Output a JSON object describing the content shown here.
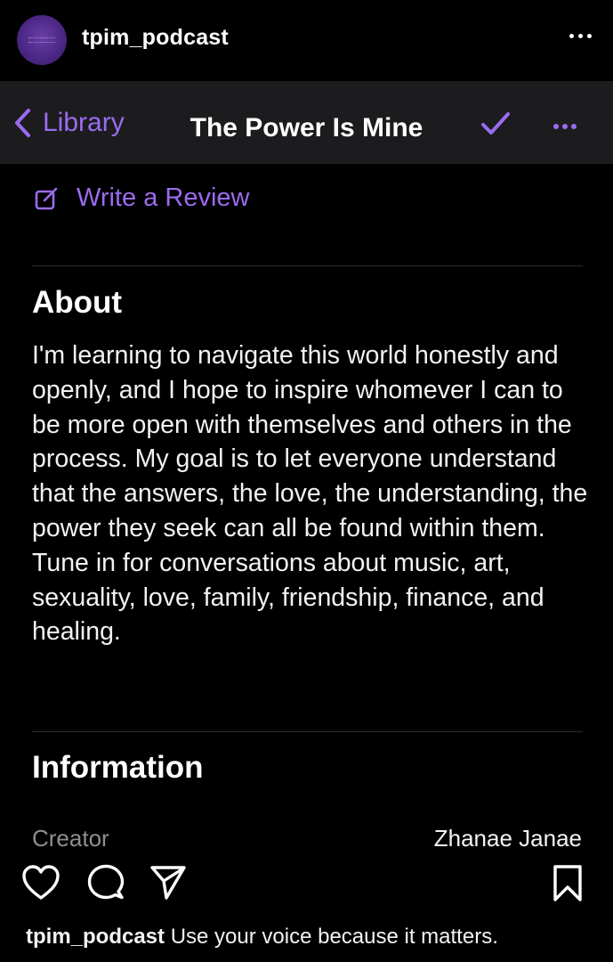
{
  "post": {
    "username": "tpim_podcast",
    "more_icon": "more-horizontal-icon"
  },
  "nav": {
    "back_label": "Library",
    "title": "The Power Is Mine",
    "check_icon": "checkmark-icon",
    "more_icon": "more-horizontal-icon"
  },
  "review": {
    "label": "Write a Review",
    "icon": "compose-icon"
  },
  "about": {
    "title": "About",
    "text": "I'm learning to navigate this world honestly and openly, and I hope to inspire whomever I can to be more open with themselves and others in the process. My goal is to let everyone understand that the answers, the love, the understanding, the power they seek can all be found within them. Tune in for conversations about music, art, sexuality, love, family, friendship, finance, and healing."
  },
  "information": {
    "title": "Information",
    "rows": [
      {
        "key": "Creator",
        "value": "Zhanae Janae"
      }
    ]
  },
  "actions": {
    "like_icon": "heart-icon",
    "comment_icon": "comment-icon",
    "share_icon": "send-icon",
    "save_icon": "bookmark-icon"
  },
  "caption": {
    "username": "tpim_podcast",
    "text": "Use your voice because it matters."
  },
  "colors": {
    "accent": "#9b6bf0",
    "background": "#000000",
    "navbar": "#1c1c1e",
    "secondary_text": "#8e8e93"
  }
}
